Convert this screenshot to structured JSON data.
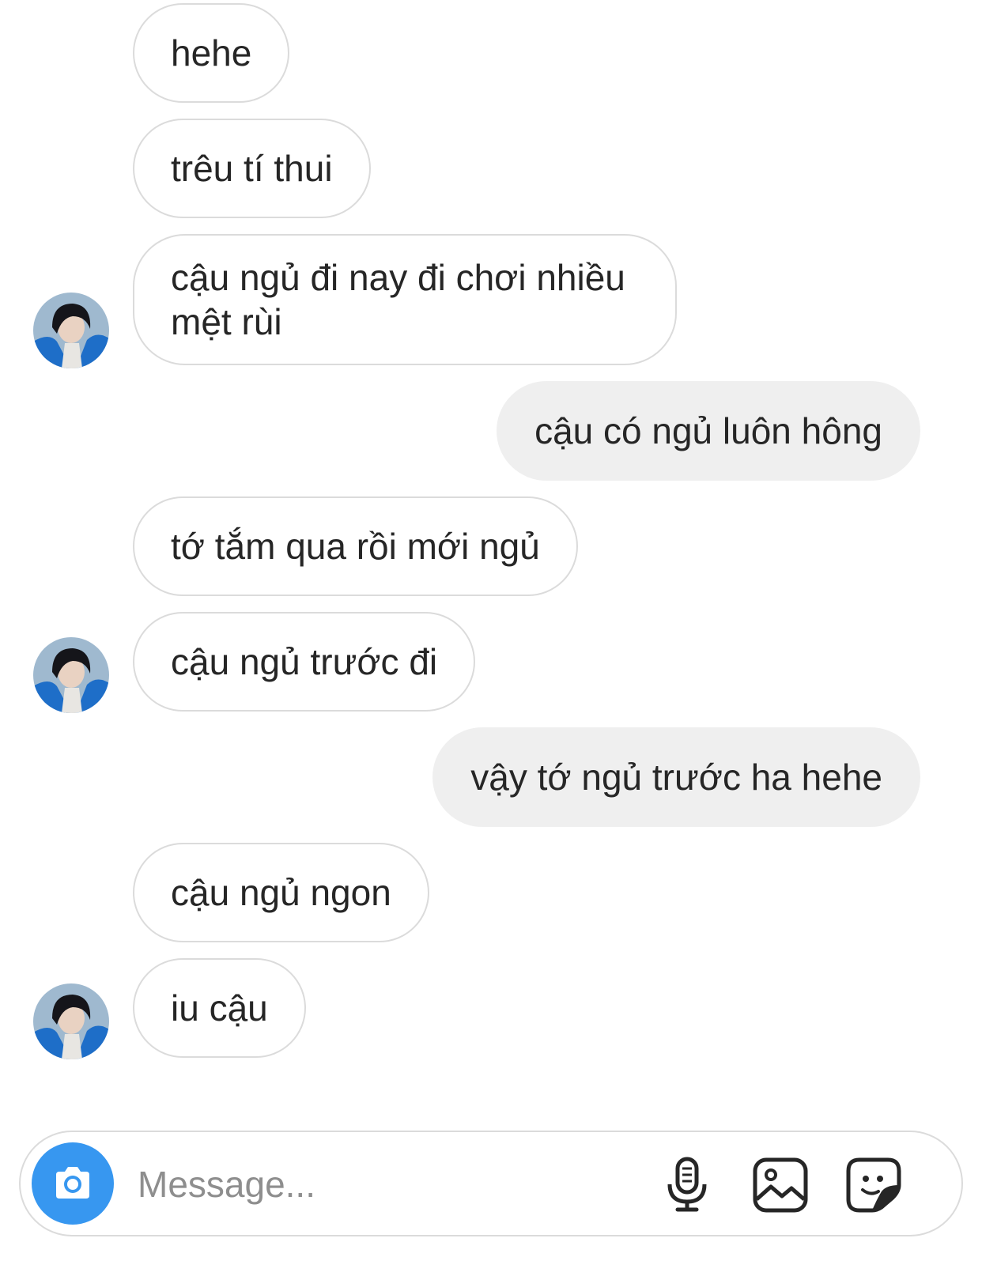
{
  "conversation": {
    "messages": [
      {
        "side": "incoming",
        "text": "hehe",
        "avatar": false
      },
      {
        "side": "incoming",
        "text": "trêu tí thui",
        "avatar": false
      },
      {
        "side": "incoming",
        "text": "cậu ngủ đi nay đi chơi nhiều mệt rùi",
        "avatar": true
      },
      {
        "side": "outgoing",
        "text": "cậu có ngủ luôn hông",
        "avatar": false
      },
      {
        "side": "incoming",
        "text": "tớ tắm qua rồi mới ngủ",
        "avatar": false
      },
      {
        "side": "incoming",
        "text": "cậu ngủ trước đi",
        "avatar": true
      },
      {
        "side": "outgoing",
        "text": "vậy tớ ngủ trước ha hehe",
        "avatar": false
      },
      {
        "side": "incoming",
        "text": "cậu ngủ ngon",
        "avatar": false
      },
      {
        "side": "incoming",
        "text": "iu cậu",
        "avatar": true
      }
    ]
  },
  "composer": {
    "placeholder": "Message...",
    "value": "",
    "camera_icon": "camera-icon",
    "mic_icon": "microphone-icon",
    "gallery_icon": "image-icon",
    "sticker_icon": "sticker-icon"
  },
  "colors": {
    "incoming_bubble_border": "#dbdbdb",
    "outgoing_bubble_bg": "#efefef",
    "camera_button": "#3797f0",
    "text": "#262626",
    "placeholder": "#8e8e8e"
  }
}
